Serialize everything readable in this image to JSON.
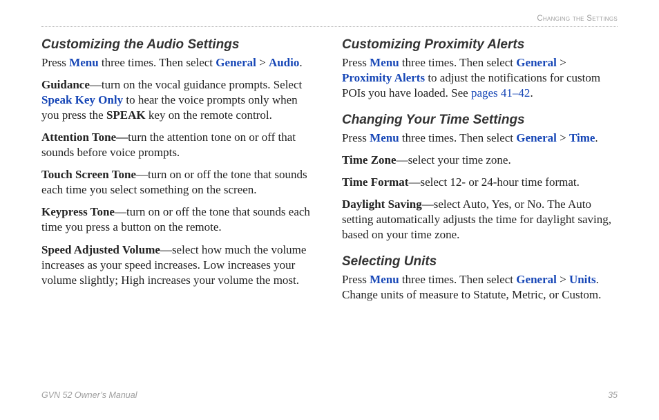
{
  "header": {
    "running_head": "Changing the Settings"
  },
  "left": {
    "audio": {
      "heading": "Customizing the Audio Settings",
      "intro_a": "Press ",
      "menu": "Menu",
      "intro_b": " three times. Then select ",
      "general": "General",
      "gt": " > ",
      "audio_link": "Audio",
      "intro_c": ".",
      "guidance_b": "Guidance",
      "guidance_t1": "—turn on the vocal guidance prompts. Select ",
      "speak_key_only": "Speak Key Only",
      "guidance_t2": " to hear the voice prompts only when you press the ",
      "speak": "SPEAK",
      "guidance_t3": " key on the remote control.",
      "attention_b": "Attention Tone—",
      "attention_t": "turn the attention tone on or off that sounds before voice prompts.",
      "touch_b": "Touch Screen Tone",
      "touch_t": "—turn on or off the tone that sounds each time you select something on the screen.",
      "keypress_b": "Keypress Tone",
      "keypress_t": "—turn on or off the tone that sounds each time you press a button on the remote.",
      "sav_b": "Speed Adjusted Volume",
      "sav_t": "—select how much the volume increases as your speed increases. Low increases your volume slightly; High increases your volume the most."
    }
  },
  "right": {
    "prox": {
      "heading": "Customizing Proximity Alerts",
      "intro_a": "Press ",
      "menu": "Menu",
      "intro_b": " three times. Then select ",
      "general": "General",
      "gt": " > ",
      "proximity": "Proximity Alerts",
      "intro_c": " to adjust the notifications for custom POIs you have loaded. See ",
      "pages": "pages 41–42",
      "intro_d": "."
    },
    "time": {
      "heading": "Changing Your Time Settings",
      "intro_a": "Press ",
      "menu": "Menu",
      "intro_b": " three times. Then select ",
      "general": "General",
      "gt": " > ",
      "time_link": "Time",
      "intro_c": ".",
      "tz_b": "Time Zone",
      "tz_t": "—select your time zone.",
      "tf_b": "Time Format",
      "tf_t": "—select 12- or 24-hour time format.",
      "ds_b": "Daylight Saving",
      "ds_t": "—select Auto, Yes, or No. The Auto setting automatically adjusts the time for daylight saving, based on your time zone."
    },
    "units": {
      "heading": "Selecting Units",
      "intro_a": "Press ",
      "menu": "Menu",
      "intro_b": " three times. Then select ",
      "general": "General",
      "gt": " > ",
      "units_link": "Units",
      "intro_c": ". Change units of measure to Statute, Metric, or Custom."
    }
  },
  "footer": {
    "left": "GVN 52 Owner’s Manual",
    "right": "35"
  }
}
